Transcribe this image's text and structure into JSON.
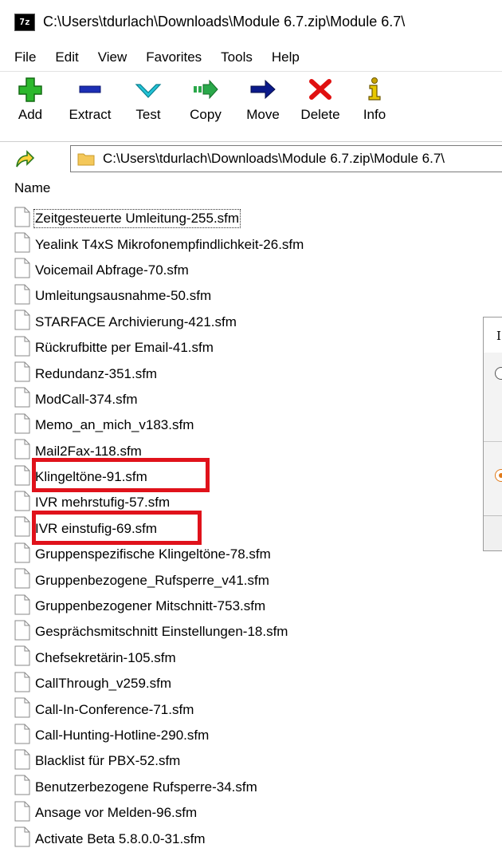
{
  "window": {
    "app_icon_text": "7z",
    "title": "C:\\Users\\tdurlach\\Downloads\\Module 6.7.zip\\Module 6.7\\"
  },
  "menu": [
    "File",
    "Edit",
    "View",
    "Favorites",
    "Tools",
    "Help"
  ],
  "toolbar": {
    "add": "Add",
    "extract": "Extract",
    "test": "Test",
    "copy": "Copy",
    "move": "Move",
    "delete": "Delete",
    "info": "Info"
  },
  "address": {
    "path": "C:\\Users\\tdurlach\\Downloads\\Module 6.7.zip\\Module 6.7\\"
  },
  "list": {
    "column_name": "Name",
    "files": [
      "Zeitgesteuerte Umleitung-255.sfm",
      "Yealink T4xS Mikrofonempfindlichkeit-26.sfm",
      "Voicemail Abfrage-70.sfm",
      "Umleitungsausnahme-50.sfm",
      "STARFACE Archivierung-421.sfm",
      "Rückrufbitte per Email-41.sfm",
      "Redundanz-351.sfm",
      "ModCall-374.sfm",
      "Memo_an_mich_v183.sfm",
      "Mail2Fax-118.sfm",
      "Klingeltöne-91.sfm",
      "IVR mehrstufig-57.sfm",
      "IVR einstufig-69.sfm",
      "Gruppenspezifische Klingeltöne-78.sfm",
      "Gruppenbezogene_Rufsperre_v41.sfm",
      "Gruppenbezogener Mitschnitt-753.sfm",
      "Gesprächsmitschnitt Einstellungen-18.sfm",
      "Chefsekretärin-105.sfm",
      "CallThrough_v259.sfm",
      "Call-In-Conference-71.sfm",
      "Call-Hunting-Hotline-290.sfm",
      "Blacklist für PBX-52.sfm",
      "Benutzerbezogene Rufsperre-34.sfm",
      "Ansage vor Melden-96.sfm",
      "Activate Beta 5.8.0.0-31.sfm"
    ]
  },
  "dialog": {
    "title_fragment": "I"
  },
  "colors": {
    "highlight": "#e0121b",
    "add_icon": "#2db82d",
    "extract_icon": "#1c2fb5",
    "test_icon": "#22c3d6",
    "copy_icon": "#2aa84a",
    "move_icon": "#0b1a8a",
    "delete_icon": "#e01010",
    "info_icon": "#c9a400"
  }
}
